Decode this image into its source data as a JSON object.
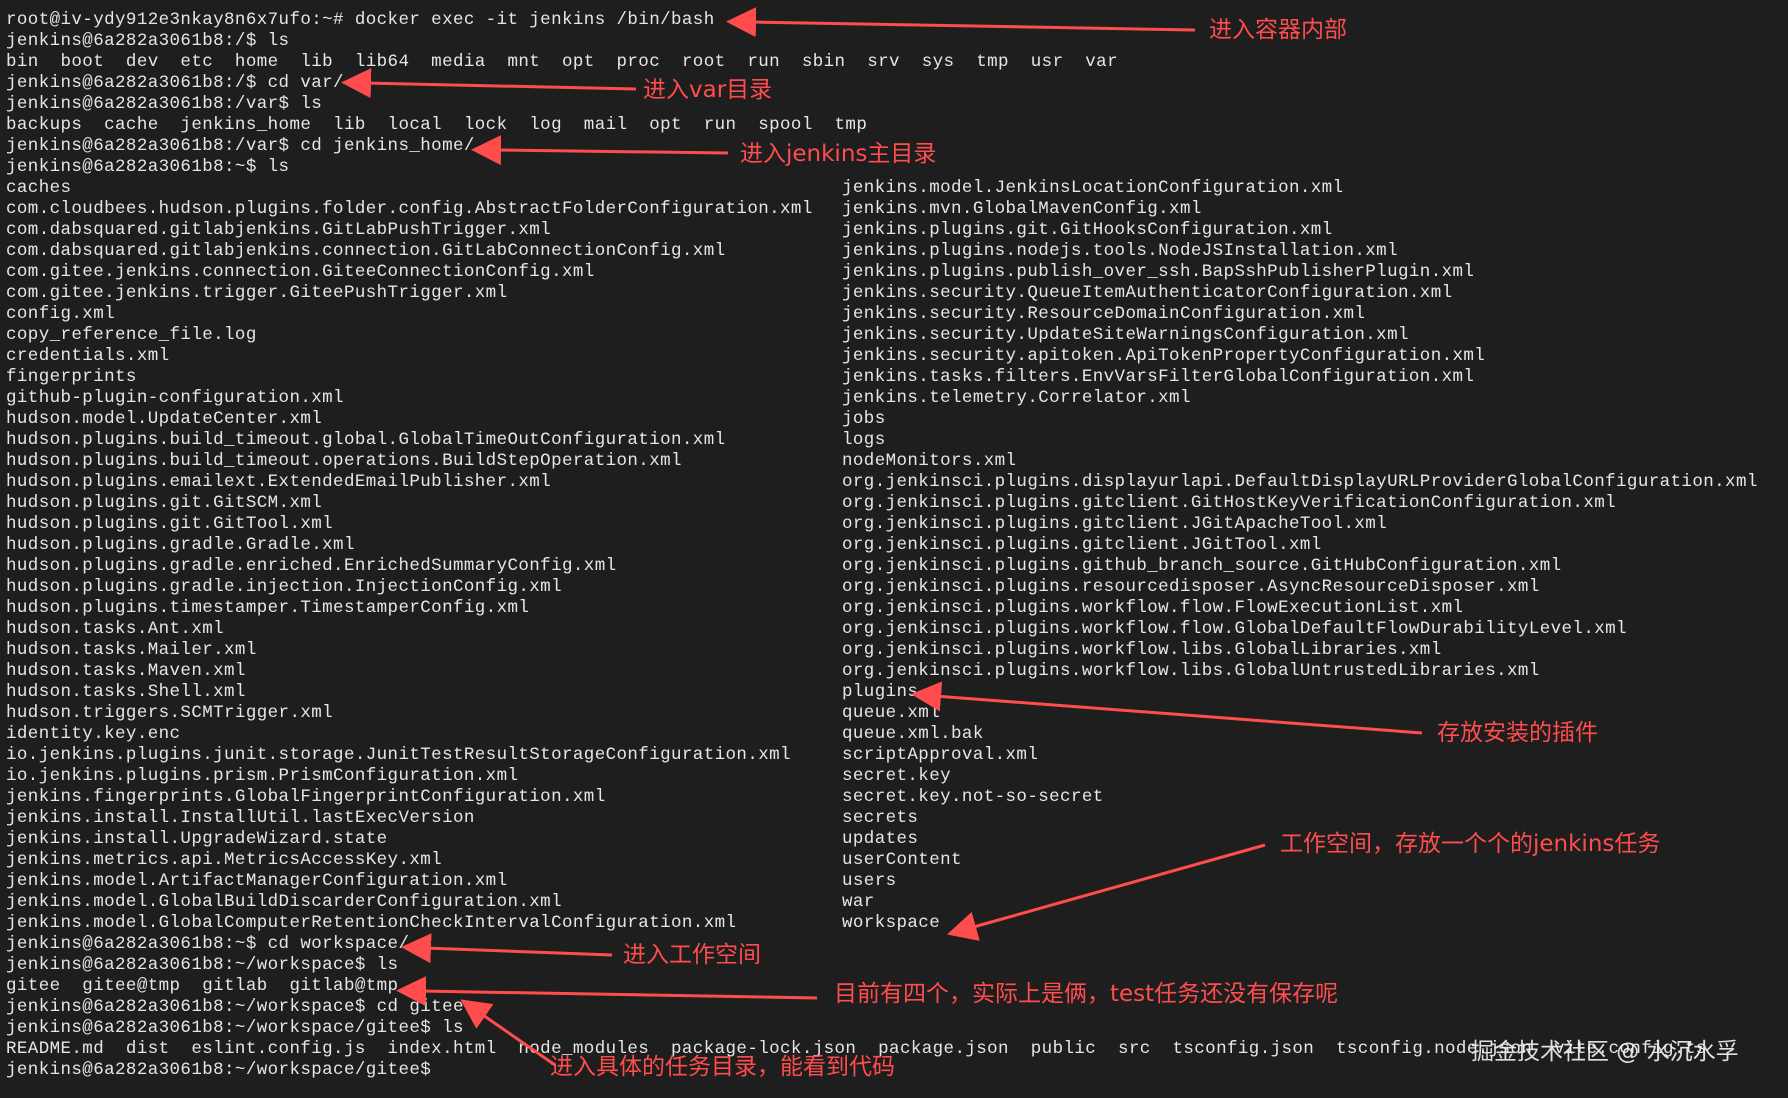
{
  "terminal": {
    "prompt_lines": [
      "root@iv-ydy912e3nkay8n6x7ufo:~# docker exec -it jenkins /bin/bash",
      "jenkins@6a282a3061b8:/$ ls",
      "bin  boot  dev  etc  home  lib  lib64  media  mnt  opt  proc  root  run  sbin  srv  sys  tmp  usr  var",
      "jenkins@6a282a3061b8:/$ cd var/",
      "jenkins@6a282a3061b8:/var$ ls",
      "backups  cache  jenkins_home  lib  local  lock  log  mail  opt  run  spool  tmp",
      "jenkins@6a282a3061b8:/var$ cd jenkins_home/",
      "jenkins@6a282a3061b8:~$ ls"
    ],
    "listing_left": [
      "caches",
      "com.cloudbees.hudson.plugins.folder.config.AbstractFolderConfiguration.xml",
      "com.dabsquared.gitlabjenkins.GitLabPushTrigger.xml",
      "com.dabsquared.gitlabjenkins.connection.GitLabConnectionConfig.xml",
      "com.gitee.jenkins.connection.GiteeConnectionConfig.xml",
      "com.gitee.jenkins.trigger.GiteePushTrigger.xml",
      "config.xml",
      "copy_reference_file.log",
      "credentials.xml",
      "fingerprints",
      "github-plugin-configuration.xml",
      "hudson.model.UpdateCenter.xml",
      "hudson.plugins.build_timeout.global.GlobalTimeOutConfiguration.xml",
      "hudson.plugins.build_timeout.operations.BuildStepOperation.xml",
      "hudson.plugins.emailext.ExtendedEmailPublisher.xml",
      "hudson.plugins.git.GitSCM.xml",
      "hudson.plugins.git.GitTool.xml",
      "hudson.plugins.gradle.Gradle.xml",
      "hudson.plugins.gradle.enriched.EnrichedSummaryConfig.xml",
      "hudson.plugins.gradle.injection.InjectionConfig.xml",
      "hudson.plugins.timestamper.TimestamperConfig.xml",
      "hudson.tasks.Ant.xml",
      "hudson.tasks.Mailer.xml",
      "hudson.tasks.Maven.xml",
      "hudson.tasks.Shell.xml",
      "hudson.triggers.SCMTrigger.xml",
      "identity.key.enc",
      "io.jenkins.plugins.junit.storage.JunitTestResultStorageConfiguration.xml",
      "io.jenkins.plugins.prism.PrismConfiguration.xml",
      "jenkins.fingerprints.GlobalFingerprintConfiguration.xml",
      "jenkins.install.InstallUtil.lastExecVersion",
      "jenkins.install.UpgradeWizard.state",
      "jenkins.metrics.api.MetricsAccessKey.xml",
      "jenkins.model.ArtifactManagerConfiguration.xml",
      "jenkins.model.GlobalBuildDiscarderConfiguration.xml",
      "jenkins.model.GlobalComputerRetentionCheckIntervalConfiguration.xml"
    ],
    "listing_right": [
      "jenkins.model.JenkinsLocationConfiguration.xml",
      "jenkins.mvn.GlobalMavenConfig.xml",
      "jenkins.plugins.git.GitHooksConfiguration.xml",
      "jenkins.plugins.nodejs.tools.NodeJSInstallation.xml",
      "jenkins.plugins.publish_over_ssh.BapSshPublisherPlugin.xml",
      "jenkins.security.QueueItemAuthenticatorConfiguration.xml",
      "jenkins.security.ResourceDomainConfiguration.xml",
      "jenkins.security.UpdateSiteWarningsConfiguration.xml",
      "jenkins.security.apitoken.ApiTokenPropertyConfiguration.xml",
      "jenkins.tasks.filters.EnvVarsFilterGlobalConfiguration.xml",
      "jenkins.telemetry.Correlator.xml",
      "jobs",
      "logs",
      "nodeMonitors.xml",
      "org.jenkinsci.plugins.displayurlapi.DefaultDisplayURLProviderGlobalConfiguration.xml",
      "org.jenkinsci.plugins.gitclient.GitHostKeyVerificationConfiguration.xml",
      "org.jenkinsci.plugins.gitclient.JGitApacheTool.xml",
      "org.jenkinsci.plugins.gitclient.JGitTool.xml",
      "org.jenkinsci.plugins.github_branch_source.GitHubConfiguration.xml",
      "org.jenkinsci.plugins.resourcedisposer.AsyncResourceDisposer.xml",
      "org.jenkinsci.plugins.workflow.flow.FlowExecutionList.xml",
      "org.jenkinsci.plugins.workflow.flow.GlobalDefaultFlowDurabilityLevel.xml",
      "org.jenkinsci.plugins.workflow.libs.GlobalLibraries.xml",
      "org.jenkinsci.plugins.workflow.libs.GlobalUntrustedLibraries.xml",
      "plugins",
      "queue.xml",
      "queue.xml.bak",
      "scriptApproval.xml",
      "secret.key",
      "secret.key.not-so-secret",
      "secrets",
      "updates",
      "userContent",
      "users",
      "war",
      "workspace"
    ],
    "tail_lines": [
      "jenkins@6a282a3061b8:~$ cd workspace/",
      "jenkins@6a282a3061b8:~/workspace$ ls",
      "gitee  gitee@tmp  gitlab  gitlab@tmp",
      "jenkins@6a282a3061b8:~/workspace$ cd gitee",
      "jenkins@6a282a3061b8:~/workspace/gitee$ ls",
      "README.md  dist  eslint.config.js  index.html  node_modules  package-lock.json  package.json  public  src  tsconfig.json  tsconfig.node.json  vite.config.ts",
      "jenkins@6a282a3061b8:~/workspace/gitee$ "
    ]
  },
  "annotations": {
    "enter_container": "进入容器内部",
    "enter_var": "进入var目录",
    "enter_jenkins_home": "进入jenkins主目录",
    "plugins_note": "存放安装的插件",
    "workspace_note": "工作空间，存放一个个的jenkins任务",
    "enter_workspace": "进入工作空间",
    "four_dirs_note": "目前有四个，实际上是俩，test任务还没有保存呢",
    "enter_task_dir": "进入具体的任务目录，能看到代码"
  },
  "watermark": "掘金技术社区 @ 水沉水孚",
  "colors": {
    "background": "#1e1e1e",
    "text": "#e6e6e6",
    "annotation": "#ff4d4d"
  }
}
